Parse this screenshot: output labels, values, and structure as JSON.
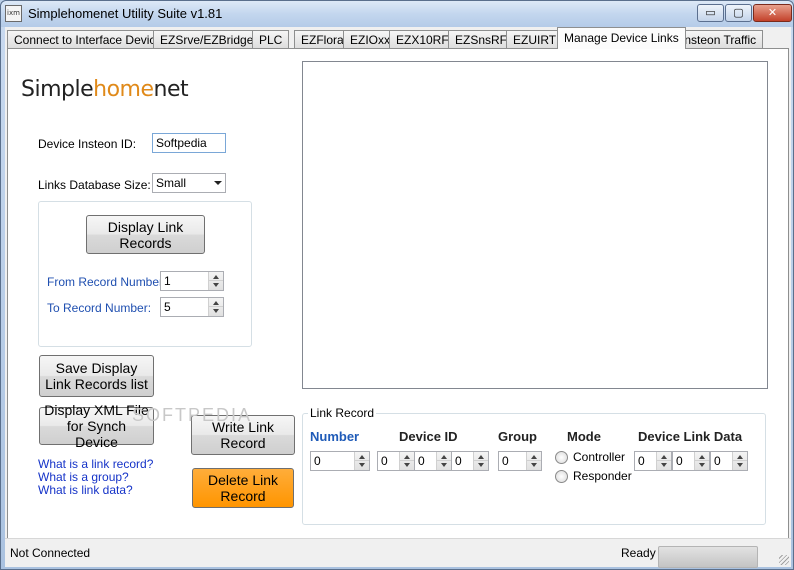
{
  "window": {
    "title": "Simplehomenet Utility Suite v1.81",
    "icon_text": "ixm",
    "controls": {
      "minimize": "▭",
      "maximize": "▢",
      "close": "✕"
    }
  },
  "tabs": [
    {
      "label": "Connect to Interface Device"
    },
    {
      "label": "EZSrve/EZBridge"
    },
    {
      "label": "PLC"
    },
    {
      "label": "EZFlora"
    },
    {
      "label": "EZIOxx"
    },
    {
      "label": "EZX10RF"
    },
    {
      "label": "EZSnsRF"
    },
    {
      "label": "EZUIRT"
    },
    {
      "label": "Manage Device Links",
      "active": true
    },
    {
      "label": "Insteon Traffic"
    }
  ],
  "logo": {
    "part1": "Simple",
    "part2": "home",
    "part3": "net"
  },
  "form": {
    "device_id_label": "Device Insteon ID:",
    "device_id_value": "Softpedia",
    "db_size_label": "Links Database Size:",
    "db_size_value": "Small",
    "display_button": "Display Link Records",
    "from_label": "From Record Number:",
    "from_value": "1",
    "to_label": "To Record Number:",
    "to_value": "5"
  },
  "buttons": {
    "save": "Save Display Link Records list",
    "display_xml": "Display XML File for Synch Device",
    "write": "Write Link Record",
    "delete": "Delete Link Record"
  },
  "links": {
    "what_record": "What is a link record?",
    "what_group": "What is a group?",
    "what_data": "What is link data?"
  },
  "link_record": {
    "caption": "Link Record",
    "headers": {
      "number": "Number",
      "device_id": "Device ID",
      "group": "Group",
      "mode": "Mode",
      "link_data": "Device Link Data"
    },
    "number_value": "0",
    "device_id_values": [
      "0",
      "0",
      "0"
    ],
    "group_value": "0",
    "mode_options": [
      "Controller",
      "Responder"
    ],
    "link_data_values": [
      "0",
      "0",
      "0"
    ]
  },
  "watermark": "SOFTPEDIA",
  "status": {
    "connection": "Not Connected",
    "state": "Ready"
  },
  "colors": {
    "accent_orange": "#ff9900",
    "header_blue": "#1f5bb8",
    "link_blue": "#1533c8"
  }
}
